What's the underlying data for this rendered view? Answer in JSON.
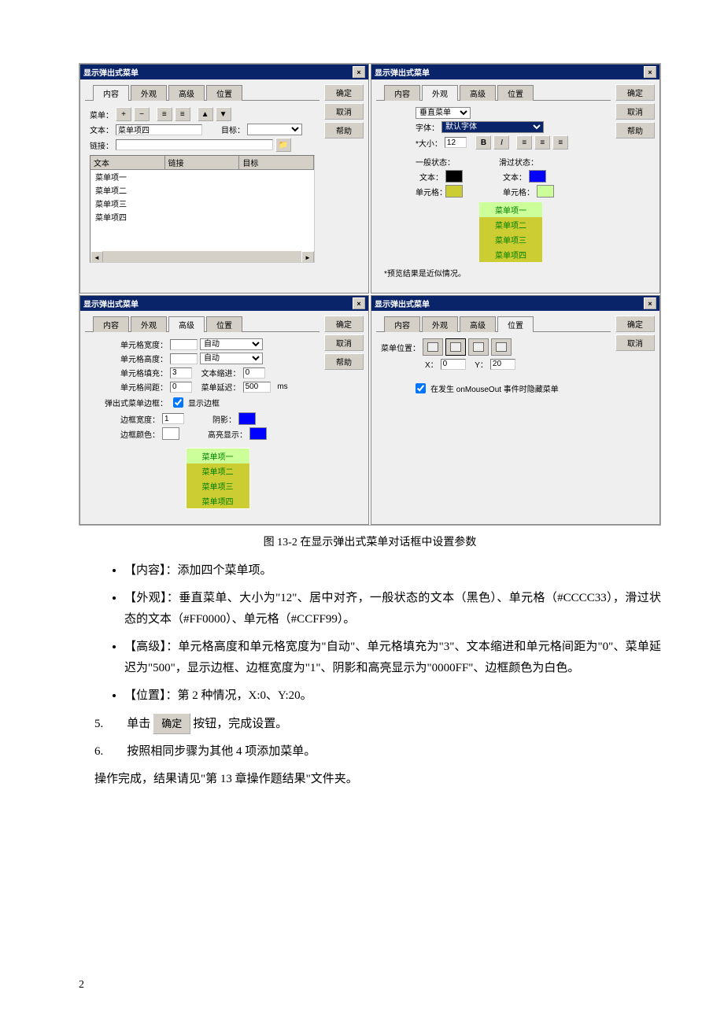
{
  "dialog_title": "显示弹出式菜单",
  "tabs": [
    "内容",
    "外观",
    "高级",
    "位置"
  ],
  "side_buttons": [
    "确定",
    "取消",
    "帮助"
  ],
  "menu_items": [
    "菜单项一",
    "菜单项二",
    "菜单项三",
    "菜单项四"
  ],
  "d1": {
    "menu_lbl": "菜单：",
    "text_lbl": "文本：",
    "text_val": "菜单项四",
    "target_lbl": "目标：",
    "link_lbl": "链接：",
    "cols": [
      "文本",
      "链接",
      "目标"
    ]
  },
  "d2": {
    "type_lbl": "垂直菜单",
    "font_lbl": "字体：",
    "font_val": "默认字体",
    "size_lbl": "*大小：",
    "size_val": "12",
    "normal_lbl": "一般状态：",
    "hover_lbl": "滑过状态：",
    "text_lbl": "文本：",
    "cell_lbl": "单元格：",
    "note": "*预览结果是近似情况。"
  },
  "d3": {
    "w_lbl": "单元格宽度：",
    "h_lbl": "单元格高度：",
    "auto": "自动",
    "pad_lbl": "单元格填充：",
    "pad_val": "3",
    "indent_lbl": "文本缩进：",
    "indent_val": "0",
    "space_lbl": "单元格间距：",
    "space_val": "0",
    "delay_lbl": "菜单延迟：",
    "delay_val": "500",
    "ms": "ms",
    "border_group": "弹出式菜单边框：",
    "show_border": "显示边框",
    "bw_lbl": "边框宽度：",
    "bw_val": "1",
    "shadow_lbl": "阴影：",
    "bc_lbl": "边框颜色：",
    "hl_lbl": "高亮显示："
  },
  "d4": {
    "pos_lbl": "菜单位置：",
    "x_lbl": "X：",
    "x_val": "0",
    "y_lbl": "Y：",
    "y_val": "20",
    "hide_lbl": "在发生 onMouseOut 事件时隐藏菜单"
  },
  "caption": "图 13-2    在显示弹出式菜单对话框中设置参数",
  "bullets": [
    "【内容】：添加四个菜单项。",
    "【外观】：垂直菜单、大小为\"12\"、居中对齐，一般状态的文本（黑色）、单元格（#CCCC33），滑过状态的文本（#FF0000）、单元格（#CCFF99）。",
    "【高级】：单元格高度和单元格宽度为\"自动\"、单元格填充为\"3\"、文本缩进和单元格间距为\"0\"、菜单延迟为\"500\"，显示边框、边框宽度为\"1\"、阴影和高亮显示为\"0000FF\"、边框颜色为白色。",
    "【位置】：第 2 种情况，X:0、Y:20。"
  ],
  "steps": {
    "s5a": "5.　　单击",
    "s5btn": "确定",
    "s5b": "按钮，完成设置。",
    "s6": "6.　　按照相同步骤为其他 4 项添加菜单。"
  },
  "finish": "操作完成，结果请见\"第 13 章操作题结果\"文件夹。",
  "page_num": "2"
}
